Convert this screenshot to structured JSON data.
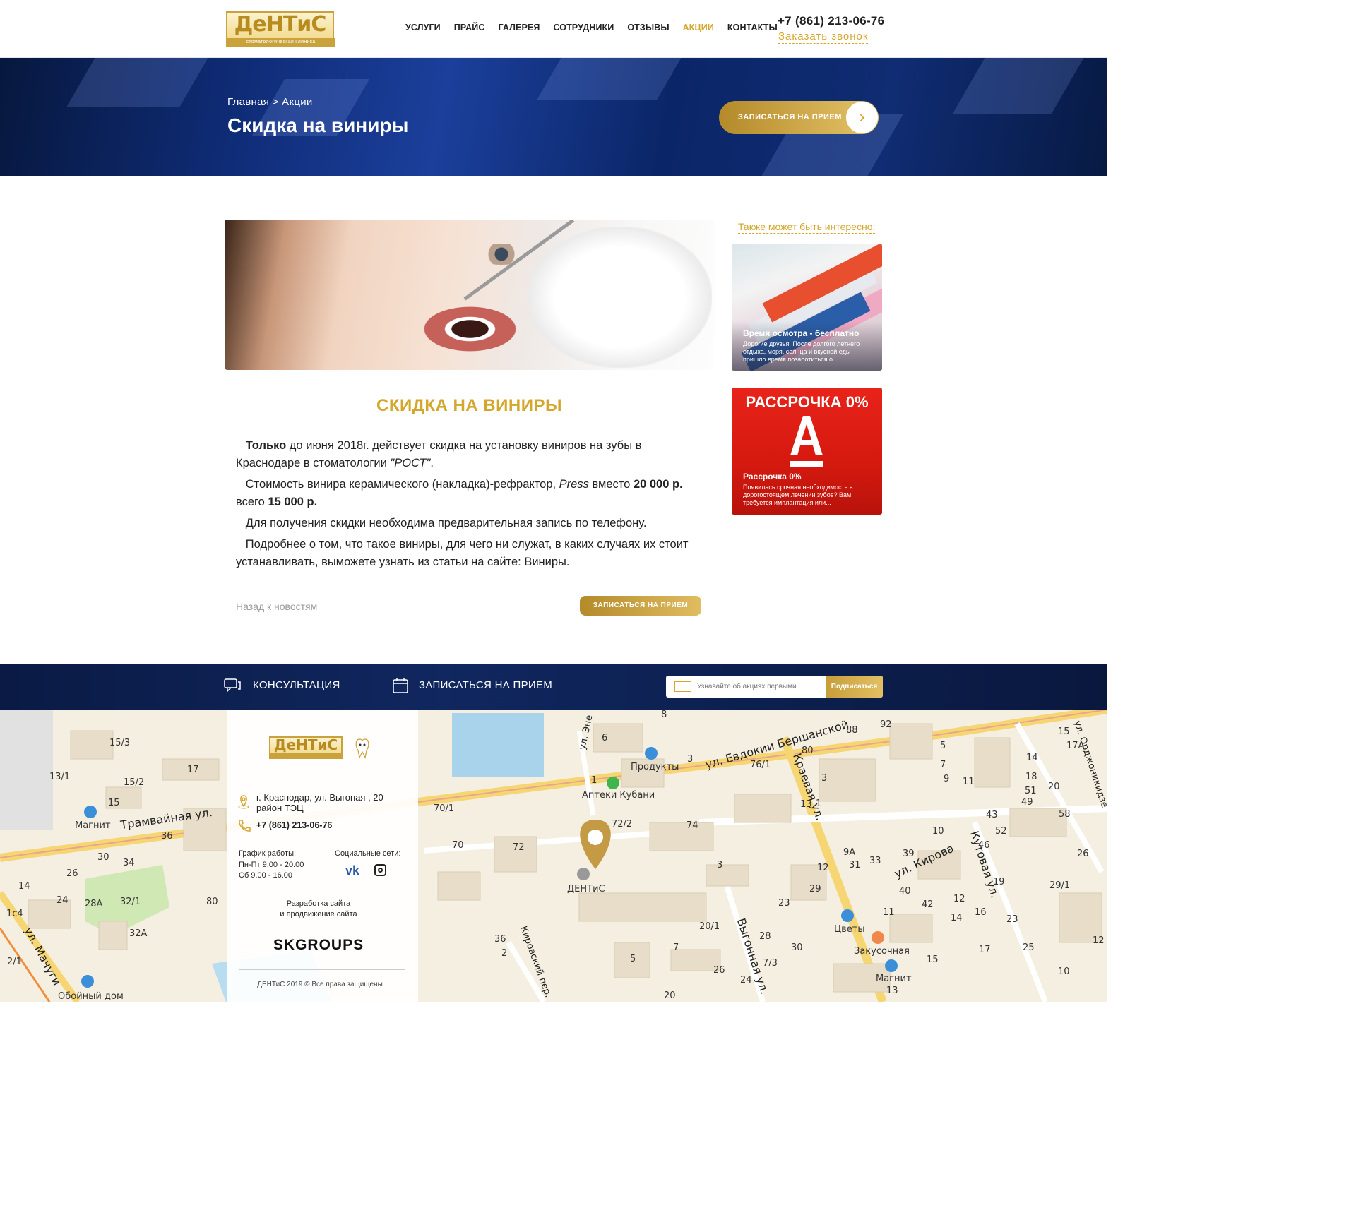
{
  "header": {
    "logo_text": "ДеНТиС",
    "logo_sub": "стоматологическая клиника",
    "nav": [
      "УСЛУГИ",
      "ПРАЙС",
      "ГАЛЕРЕЯ",
      "СОТРУДНИКИ",
      "ОТЗЫВЫ",
      "АКЦИИ",
      "КОНТАКТЫ"
    ],
    "active_nav": "АКЦИИ",
    "phone": "+7 (861) 213-06-76",
    "callback": "Заказать звонок"
  },
  "hero": {
    "breadcrumb": "Главная > Акции",
    "title": "Скидка на виниры",
    "button": "ЗАПИСАТЬСЯ НА ПРИЕМ",
    "button_arrow": "›"
  },
  "article": {
    "heading": "СКИДКА НА ВИНИРЫ",
    "p1_bold": "Только",
    "p1_a": " до июня 2018г. действует скидка на установку виниров на зубы в Краснодаре в стоматологии ",
    "p1_italic": "\"РОСТ\"",
    "p1_end": ".",
    "p2_a": "Стоимость винира керамического (накладка)-рефрактор, ",
    "p2_italic": "Press",
    "p2_b": " вместо ",
    "p2_bold1": "20 000 р.",
    "p2_c": " всего ",
    "p2_bold2": "15 000 р.",
    "p3": "Для получения скидки необходима предварительная запись по телефону.",
    "p4": "Подробнее о том, что такое виниры, для чего ни служат, в каких случаях их стоит устанавливать, выможете узнать из статьи на сайте: Виниры.",
    "back_link": "Назад к новостям",
    "button": "ЗАПИСАТЬСЯ НА ПРИЕМ"
  },
  "sidebar": {
    "heading": "Также может быть интересно:",
    "cards": [
      {
        "title": "Время осмотра - бесплатно",
        "text": "Дорогие друзья! После долгого летнего отдыха, моря, солнца и вкусной еды пришло время позаботиться о..."
      },
      {
        "banner": "РАССРОЧКА 0%",
        "title": "Рассрочка 0%",
        "text": "Появилась срочная необходимость в дорогостоящем лечении зубов? Вам требуется имплантация или..."
      }
    ]
  },
  "band": {
    "consult": "КОНСУЛЬТАЦИЯ",
    "appointment": "ЗАПИСАТЬСЯ НА ПРИЕМ",
    "subscribe_placeholder": "Узнавайте об акциях первыми",
    "subscribe_button": "Подписаться"
  },
  "footer": {
    "logo_text": "ДеНТиС",
    "address": [
      "г. Краснодар, ул. Выгоная , 20",
      "район ТЭЦ"
    ],
    "phone": "+7 (861) 213-06-76",
    "schedule_heading": "График работы:",
    "schedule": [
      "Пн-Пт  9.00 - 20.00",
      "Сб  9.00 - 16.00"
    ],
    "social_heading": "Социальные сети:",
    "vk": "vk",
    "dev": [
      "Разработка сайта",
      "и продвижение сайта"
    ],
    "studio": "SKGROUPS",
    "copyright": "ДЕНТиС 2019 © Все права защищены"
  },
  "map": {
    "streets": [
      "Трамвайная ул.",
      "ул. Евдокии Бершанской",
      "Краевая ул.",
      "ул. Кирова",
      "Кутовая ул.",
      "Выгонная ул.",
      "Кировский пер.",
      "ул. Мачуги",
      "ул. Орджоникидзе",
      "ул. Эне"
    ],
    "places": [
      "Магнит",
      "Продукты",
      "Аптеки Кубани",
      "ДЕНТиС",
      "Цветы",
      "Закусочная",
      "Магнит",
      "Обойный дом"
    ],
    "numbers": [
      "15/3",
      "17",
      "13/1",
      "15/2",
      "15",
      "36",
      "30",
      "34",
      "26",
      "14",
      "24",
      "28А",
      "32/1",
      "80",
      "32А",
      "8",
      "6",
      "3",
      "1",
      "70/1",
      "70",
      "72",
      "72/2",
      "74",
      "76/1",
      "88",
      "92",
      "80",
      "5",
      "7",
      "9",
      "11",
      "3",
      "13",
      "15",
      "17А",
      "14",
      "18",
      "51",
      "49",
      "20",
      "43",
      "58",
      "52",
      "46",
      "26",
      "19",
      "29/1",
      "1",
      "3",
      "12",
      "29",
      "23",
      "42",
      "12",
      "14",
      "16",
      "23",
      "25",
      "17",
      "15",
      "13",
      "12",
      "9А",
      "31",
      "33",
      "39",
      "40",
      "10",
      "20/1",
      "30",
      "28",
      "7/3",
      "26",
      "24",
      "20",
      "36",
      "7",
      "5",
      "2",
      "1с4",
      "2/1",
      "11",
      "10"
    ]
  },
  "colors": {
    "gold": "#d4a72c",
    "navy": "#0f2c72",
    "red": "#e2231a"
  }
}
